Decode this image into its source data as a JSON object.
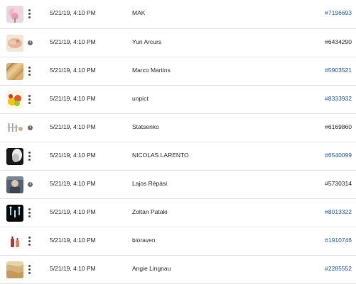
{
  "rows": [
    {
      "date": "5/21/19, 4:10 PM",
      "author": "MAK",
      "asset_id": "#7196693",
      "id_link": true,
      "marker": "more-options-icon",
      "thumb": "pink-flowers"
    },
    {
      "date": "5/21/19, 4:10 PM",
      "author": "Yuri Arcurs",
      "asset_id": "#6434290",
      "id_link": false,
      "marker": "info-icon",
      "info_glyph": "i",
      "thumb": "spa-hands"
    },
    {
      "date": "5/21/19, 4:10 PM",
      "author": "Marco Martins",
      "asset_id": "#5903521",
      "id_link": true,
      "marker": "more-options-icon",
      "thumb": "wood-planks"
    },
    {
      "date": "5/21/19, 4:10 PM",
      "author": "unpict",
      "asset_id": "#8333932",
      "id_link": true,
      "marker": "more-options-icon",
      "thumb": "fruit"
    },
    {
      "date": "5/21/19, 4:10 PM",
      "author": "Statsenko",
      "asset_id": "#6169860",
      "id_link": false,
      "marker": "info-icon",
      "info_glyph": "i",
      "thumb": "tools"
    },
    {
      "date": "5/21/19, 4:10 PM",
      "author": "NICOLAS LARENTO",
      "asset_id": "#6540099",
      "id_link": true,
      "marker": "more-options-icon",
      "thumb": "dark-smoke"
    },
    {
      "date": "5/21/19, 4:10 PM",
      "author": "Lajos Répási",
      "asset_id": "#5730314",
      "id_link": false,
      "marker": "info-icon",
      "info_glyph": "i",
      "thumb": "portrait"
    },
    {
      "date": "5/21/19, 4:10 PM",
      "author": "Zoltán Pataki",
      "asset_id": "#8013322",
      "id_link": true,
      "marker": "more-options-icon",
      "thumb": "black-figures"
    },
    {
      "date": "5/21/19, 4:10 PM",
      "author": "bioraven",
      "asset_id": "#1910746",
      "id_link": true,
      "marker": "more-options-icon",
      "thumb": "bottles"
    },
    {
      "date": "5/21/19, 4:10 PM",
      "author": "Angie Lingnau",
      "asset_id": "#2285552",
      "id_link": true,
      "marker": "more-options-icon",
      "thumb": "blonde-hair"
    }
  ],
  "colors": {
    "link": "#2b5c9e",
    "text": "#2c2c2c",
    "divider": "#e3e3e3",
    "icon": "#505050"
  }
}
